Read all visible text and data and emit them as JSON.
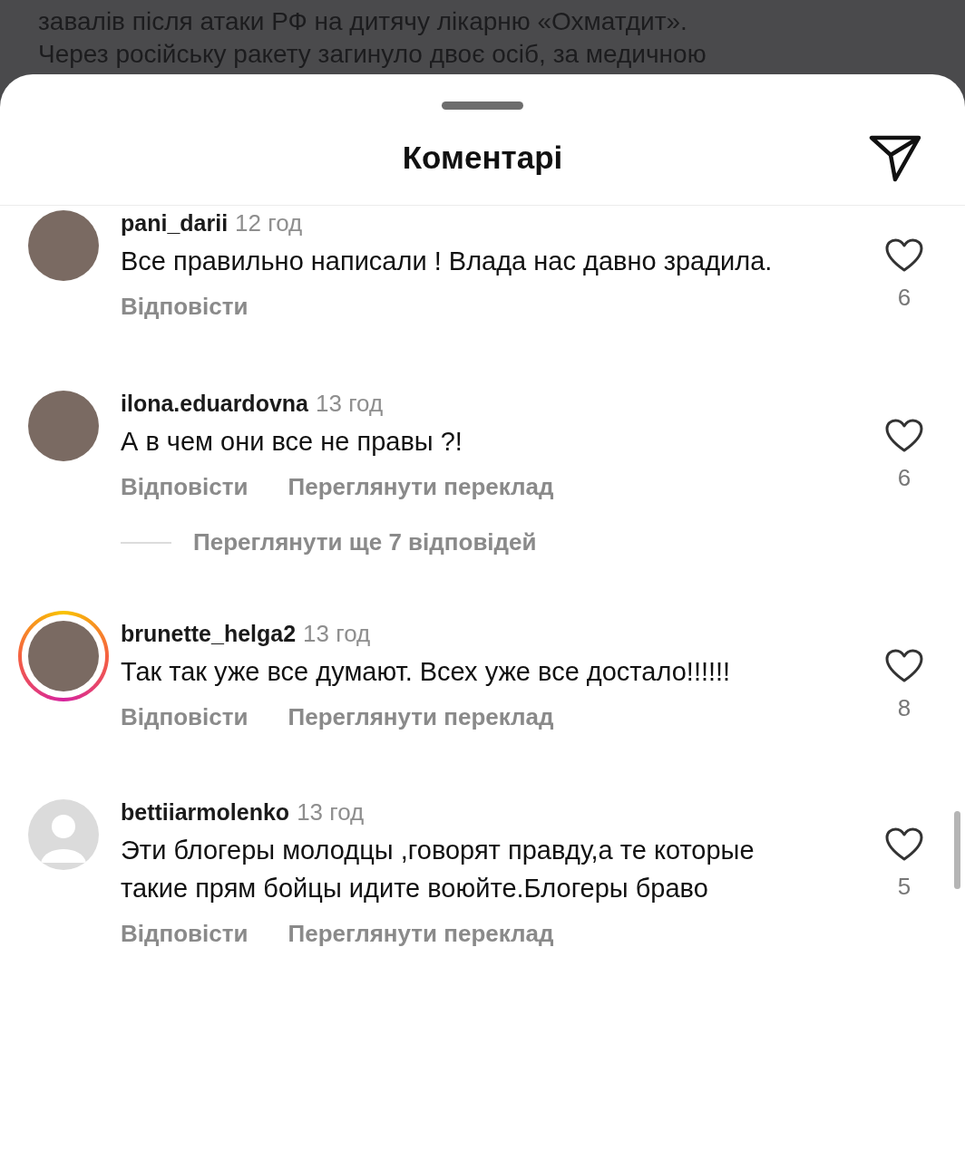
{
  "background_post": {
    "lines": [
      "завалів після атаки РФ на дитячу лікарню «Охматдит».",
      "Через російську ракету загинуло двоє осіб, за медичною"
    ]
  },
  "sheet": {
    "title": "Коментарі"
  },
  "comments": [
    {
      "username": "pani_darii",
      "time": "12 год",
      "text": "Все правильно написали ! Влада нас давно зрадила.",
      "likes": "6",
      "kind": "photo",
      "has_story": false,
      "actions": [
        "Відповісти"
      ]
    },
    {
      "username": "ilona.eduardovna",
      "time": "13 год",
      "text": "А в чем они все не правы ?!",
      "likes": "6",
      "kind": "photo",
      "has_story": false,
      "actions": [
        "Відповісти",
        "Переглянути переклад"
      ],
      "replies_link": "Переглянути ще 7 відповідей"
    },
    {
      "username": "brunette_helga2",
      "time": "13 год",
      "text": "Так так уже все думают. Всех уже все достало!!!!!!",
      "likes": "8",
      "kind": "photo",
      "has_story": true,
      "actions": [
        "Відповісти",
        "Переглянути переклад"
      ]
    },
    {
      "username": "bettiiarmolenko",
      "time": "13 год",
      "text": "Эти блогеры молодцы ,говорят правду,а те которые такие  прям бойцы идите воюйте.Блогеры браво",
      "likes": "5",
      "kind": "default",
      "has_story": false,
      "actions": [
        "Відповісти",
        "Переглянути переклад"
      ]
    }
  ]
}
